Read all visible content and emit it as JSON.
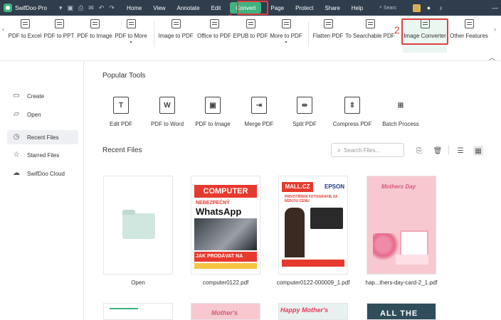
{
  "app": {
    "name": "SwifDoo·Pro"
  },
  "menu": [
    "Home",
    "View",
    "Annotate",
    "Edit",
    "Convert",
    "Page",
    "Protect",
    "Share",
    "Help"
  ],
  "menu_active": "Convert",
  "search_mini": "Searc",
  "annotations": {
    "step1": "1",
    "step2": "2"
  },
  "ribbon": [
    {
      "label": "PDF to Excel"
    },
    {
      "label": "PDF to PPT"
    },
    {
      "label": "PDF to Image"
    },
    {
      "label": "PDF to More",
      "dropdown": true
    },
    {
      "label": "Image to PDF"
    },
    {
      "label": "Office to PDF"
    },
    {
      "label": "EPUB to PDF"
    },
    {
      "label": "More to PDF",
      "dropdown": true
    },
    {
      "label": "Flatten PDF"
    },
    {
      "label": "To Searchable PDF"
    },
    {
      "label": "Image Converter"
    },
    {
      "label": "Other Features"
    }
  ],
  "sidebar": {
    "items": [
      {
        "label": "Create",
        "icon": "create-icon"
      },
      {
        "label": "Open",
        "icon": "open-folder-icon"
      },
      {
        "label": "Recent Files",
        "icon": "clock-icon",
        "active": true
      },
      {
        "label": "Starred Files",
        "icon": "star-icon"
      },
      {
        "label": "SwifDoo Cloud",
        "icon": "cloud-icon"
      }
    ]
  },
  "main": {
    "popular_tools_title": "Popular Tools",
    "tools": [
      {
        "label": "Edit PDF",
        "glyph": "T"
      },
      {
        "label": "PDF to Word",
        "glyph": "W"
      },
      {
        "label": "PDF to Image",
        "glyph": "▣"
      },
      {
        "label": "Merge PDF",
        "glyph": "⇥"
      },
      {
        "label": "Split PDF",
        "glyph": "⇹"
      },
      {
        "label": "Compress PDF",
        "glyph": "⇕"
      },
      {
        "label": "Batch Process",
        "glyph": "⊞"
      }
    ],
    "recent_files_title": "Recent Files",
    "search_placeholder": "Search Files...",
    "files": [
      {
        "name": "Open"
      },
      {
        "name": "computer0122.pdf"
      },
      {
        "name": "computer0122-000009_1.pdf"
      },
      {
        "name": "hap...thers-day-card-2_1.pdf"
      }
    ],
    "covers": {
      "c1": {
        "masthead": "COMPUTER",
        "kicker": "NEBEZPEČNÝ",
        "headline": "WhatsApp",
        "banner": "JAK PRODÁVAT NA FACEBOOKU"
      },
      "c2": {
        "brand": "MALL.CZ",
        "brand2": "EPSON",
        "tagline": "PRIVOTŘÍDNÍ FOTOGRAFIE ZA NÍZKOU CENU"
      },
      "c3": {
        "title": "Mothers Day"
      }
    },
    "row2": {
      "b": "Mother's",
      "c": "Happy Mother's",
      "d": "ALL THE"
    }
  }
}
